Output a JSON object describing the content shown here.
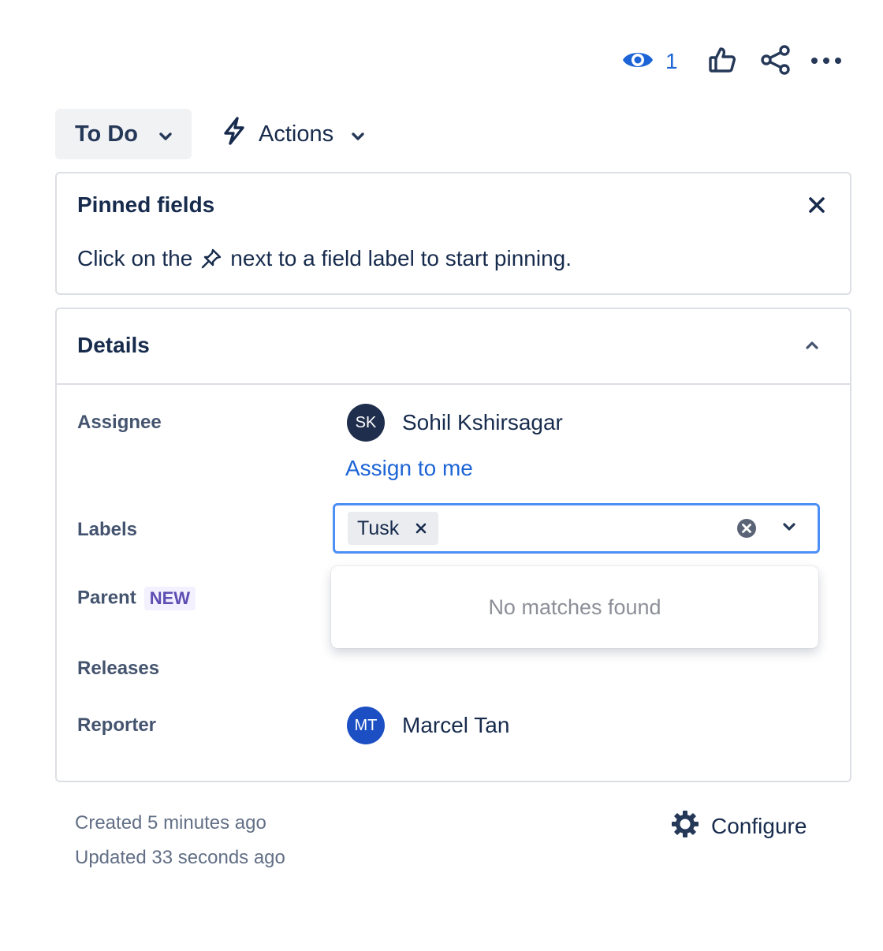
{
  "toolbar": {
    "watch_icon": "eye-icon",
    "watch_count": "1",
    "like_icon": "thumbs-up-icon",
    "share_icon": "share-icon",
    "more_icon": "more-horizontal-icon"
  },
  "status": {
    "label": "To Do",
    "icon": "chevron-down-icon"
  },
  "actions": {
    "label": "Actions",
    "icon": "lightning-icon"
  },
  "pinned": {
    "title": "Pinned fields",
    "message_before": "Click on the",
    "message_after": "next to a field label to start pinning.",
    "pin_icon": "pin-icon",
    "close_icon": "close-icon"
  },
  "details": {
    "title": "Details",
    "collapse_icon": "chevron-up-icon",
    "fields": {
      "assignee": {
        "label": "Assignee",
        "initials": "SK",
        "name": "Sohil Kshirsagar",
        "avatar_color": "#1f2e4d",
        "assign_link": "Assign to me"
      },
      "labels": {
        "label": "Labels",
        "tags": [
          "Tusk"
        ],
        "no_matches": "No matches found"
      },
      "parent": {
        "label": "Parent",
        "badge": "NEW"
      },
      "releases": {
        "label": "Releases"
      },
      "reporter": {
        "label": "Reporter",
        "initials": "MT",
        "name": "Marcel Tan",
        "avatar_color": "#1d4fc4"
      }
    }
  },
  "footer": {
    "created": "Created 5 minutes ago",
    "updated": "Updated 33 seconds ago",
    "configure": "Configure",
    "configure_icon": "gear-icon"
  },
  "colors": {
    "accent": "#1d65d6",
    "focus": "#4c8ff5",
    "badge_bg": "#f3f0ff",
    "badge_fg": "#5e4db2"
  }
}
